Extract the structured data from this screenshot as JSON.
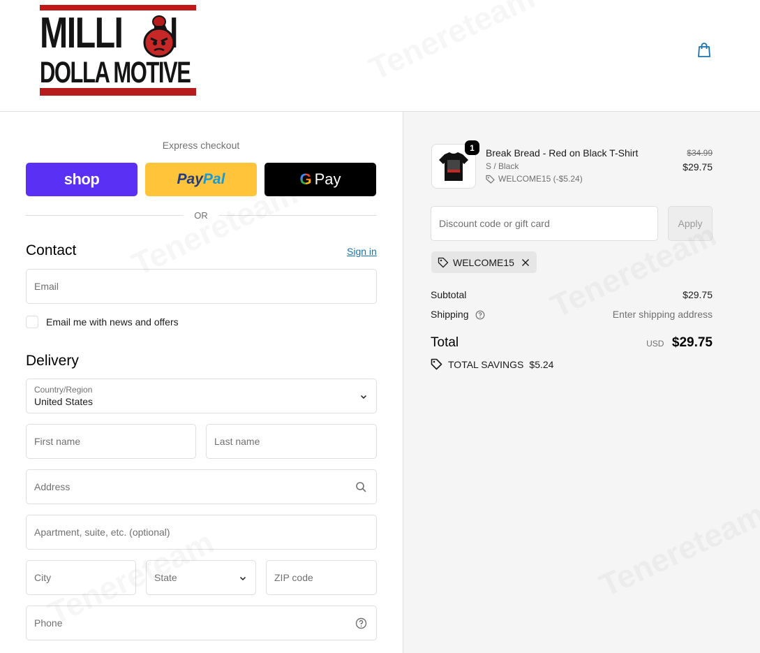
{
  "brand": {
    "line1": "MILLI",
    "line1_end": "N",
    "line2": "DOLLA MOTIVE"
  },
  "header": {
    "cart_icon": "shopping-bag-icon"
  },
  "express": {
    "title": "Express checkout",
    "shop_label": "shop",
    "paypal_label_1": "Pay",
    "paypal_label_2": "Pal",
    "gpay_g": "G",
    "gpay_label": "Pay",
    "or": "OR"
  },
  "contact": {
    "title": "Contact",
    "sign_in": "Sign in",
    "email_placeholder": "Email",
    "newsletter_label": "Email me with news and offers"
  },
  "delivery": {
    "title": "Delivery",
    "country_label": "Country/Region",
    "country_value": "United States",
    "first_name_placeholder": "First name",
    "last_name_placeholder": "Last name",
    "address_placeholder": "Address",
    "apartment_placeholder": "Apartment, suite, etc. (optional)",
    "city_placeholder": "City",
    "state_placeholder": "State",
    "zip_placeholder": "ZIP code",
    "phone_placeholder": "Phone"
  },
  "order": {
    "quantity": "1",
    "product_name": "Break Bread - Red on Black T-Shirt",
    "variant": "S / Black",
    "item_discount": "WELCOME15 (-$5.24)",
    "price_original": "$34.99",
    "price_final": "$29.75",
    "discount_placeholder": "Discount code or gift card",
    "apply_label": "Apply",
    "applied_code": "WELCOME15",
    "subtotal_label": "Subtotal",
    "subtotal_value": "$29.75",
    "shipping_label": "Shipping",
    "shipping_value": "Enter shipping address",
    "total_label": "Total",
    "total_currency": "USD",
    "total_value": "$29.75",
    "savings_label": "TOTAL SAVINGS",
    "savings_value": "$5.24"
  },
  "watermark_text": "Tenereteam",
  "colors": {
    "shop_purple": "#5a31f4",
    "paypal_yellow": "#ffc439",
    "link_blue": "#1773b0",
    "brand_red": "#c01818"
  }
}
